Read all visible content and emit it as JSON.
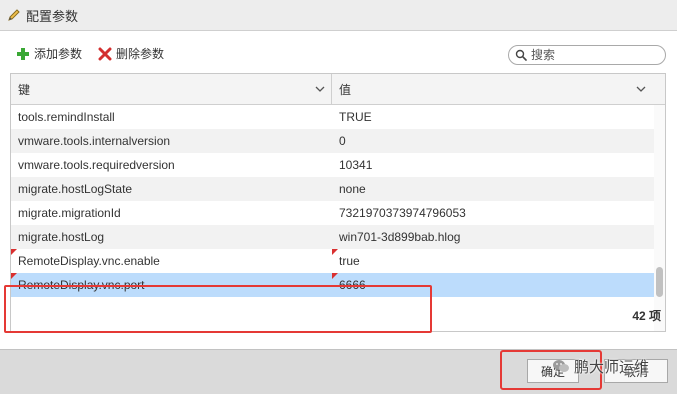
{
  "dialog": {
    "title": "配置参数"
  },
  "toolbar": {
    "add_label": "添加参数",
    "delete_label": "删除参数"
  },
  "search": {
    "placeholder": "搜索"
  },
  "table": {
    "columns": {
      "key": "键",
      "value": "值"
    },
    "rows": [
      {
        "key": "tools.remindInstall",
        "value": "TRUE"
      },
      {
        "key": "vmware.tools.internalversion",
        "value": "0"
      },
      {
        "key": "vmware.tools.requiredversion",
        "value": "10341"
      },
      {
        "key": "migrate.hostLogState",
        "value": "none"
      },
      {
        "key": "migrate.migrationId",
        "value": "7321970373974796053"
      },
      {
        "key": "migrate.hostLog",
        "value": "win701-3d899bab.hlog"
      },
      {
        "key": "RemoteDisplay.vnc.enable",
        "value": "true"
      },
      {
        "key": "RemoteDisplay.vnc.port",
        "value": "6666"
      }
    ],
    "count_label": "42 项"
  },
  "buttons": {
    "ok": "确定",
    "cancel": "取消"
  },
  "watermark": {
    "text": "鹏大师运维"
  },
  "colors": {
    "highlight": "#e53935",
    "selected_row": "#bcdcfc",
    "add_icon": "#3aa835",
    "delete_icon": "#d32f2f"
  }
}
